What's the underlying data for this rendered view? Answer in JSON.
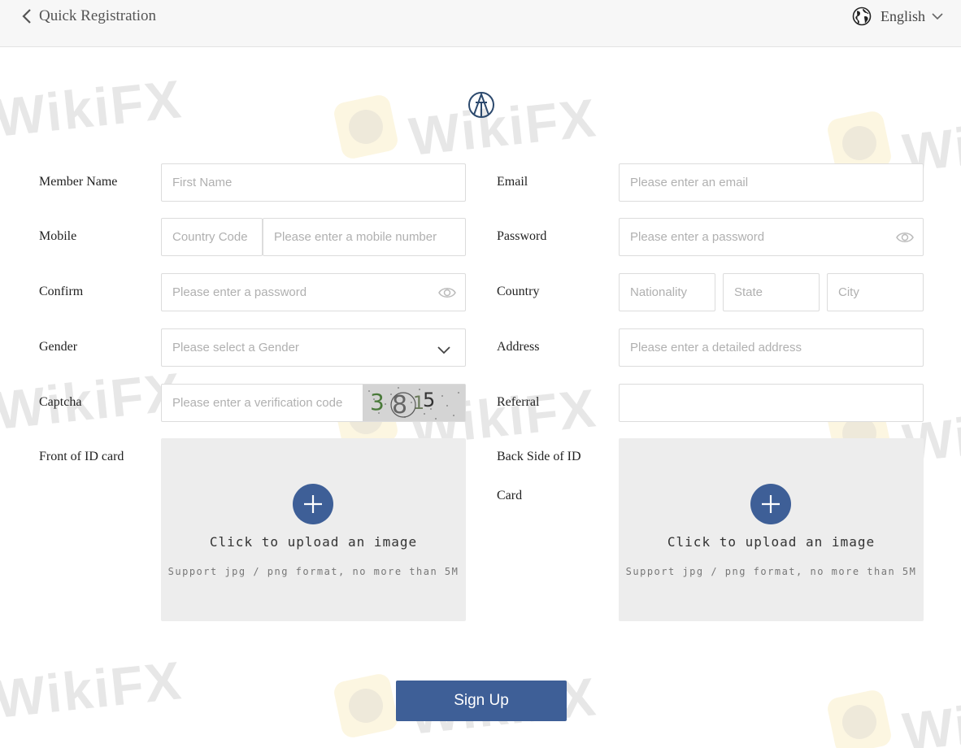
{
  "header": {
    "title": "Quick Registration",
    "language": "English"
  },
  "watermark": {
    "text": "WikiFX"
  },
  "form": {
    "member_name": {
      "label": "Member Name",
      "placeholder": "First Name"
    },
    "email": {
      "label": "Email",
      "placeholder": "Please enter an email"
    },
    "mobile": {
      "label": "Mobile",
      "country_code_placeholder": "Country Code",
      "number_placeholder": "Please enter a mobile number"
    },
    "password": {
      "label": "Password",
      "placeholder": "Please enter a password"
    },
    "confirm": {
      "label": "Confirm",
      "placeholder": "Please enter a password"
    },
    "country": {
      "label": "Country",
      "nationality_placeholder": "Nationality",
      "state_placeholder": "State",
      "city_placeholder": "City"
    },
    "gender": {
      "label": "Gender",
      "placeholder": "Please select a Gender"
    },
    "address": {
      "label": "Address",
      "placeholder": "Please enter a detailed address"
    },
    "captcha": {
      "label": "Captcha",
      "placeholder": "Please enter a verification code",
      "code": "3815"
    },
    "referral": {
      "label": "Referral",
      "placeholder": ""
    },
    "front_id": {
      "label": "Front of ID card",
      "upload_title": "Click to upload an image",
      "upload_hint": "Support jpg / png format, no more than 5M"
    },
    "back_id": {
      "label_line1": "Back Side of ID",
      "label_line2": "Card",
      "upload_title": "Click to upload an image",
      "upload_hint": "Support jpg / png format, no more than 5M"
    }
  },
  "signup_label": "Sign Up",
  "colors": {
    "primary": "#3e5f97",
    "header_bg": "#f7f7f7",
    "upload_bg": "#ededed",
    "border": "#dcdcdc"
  }
}
